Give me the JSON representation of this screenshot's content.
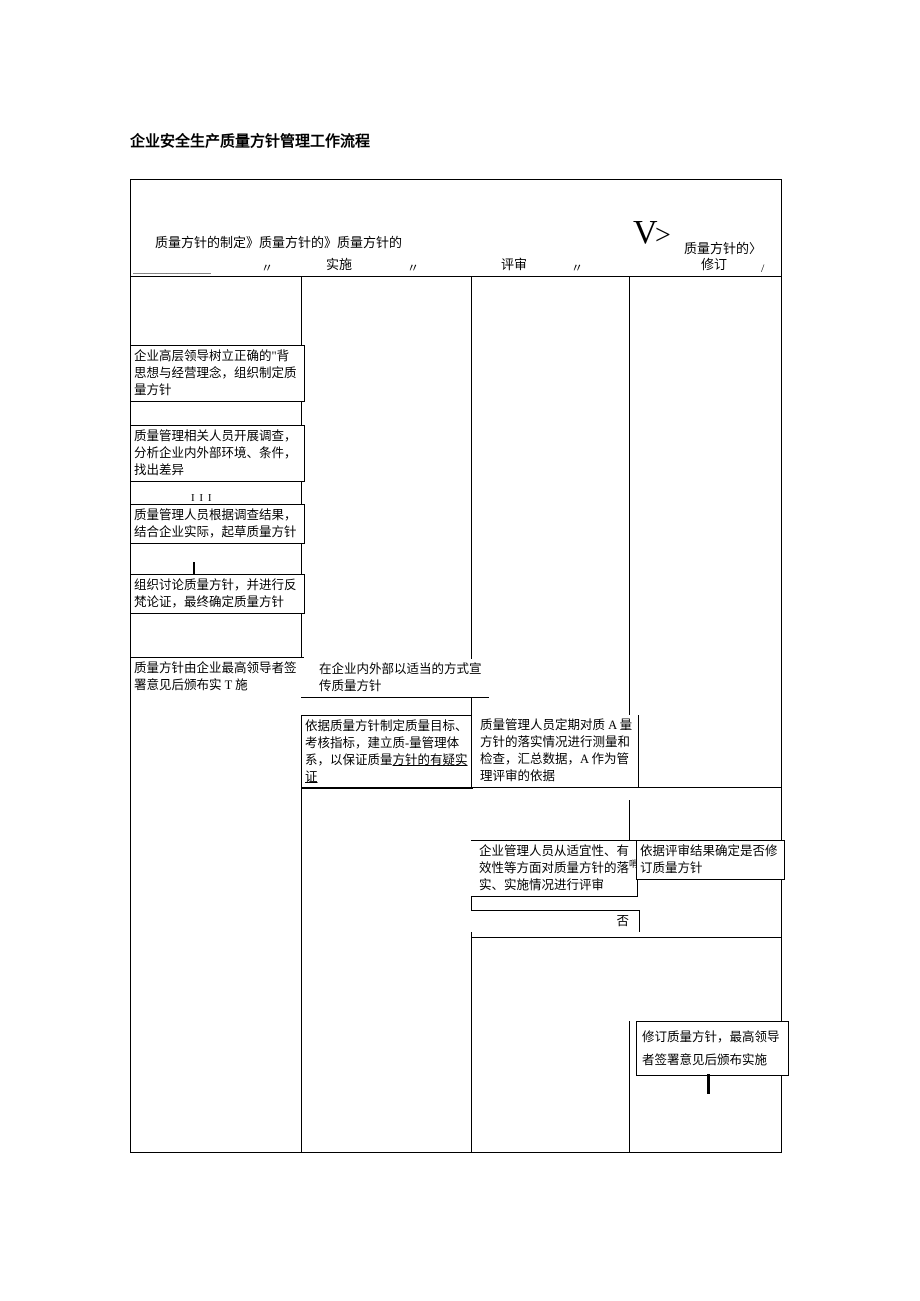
{
  "title": "企业安全生产质量方针管理工作流程",
  "header": {
    "seg1": "质量方针的制定》质量方针的》质量方针的",
    "seg2": "实施",
    "seg3": "评审",
    "seg4pre": "质量方针的〉",
    "seg4": "修订",
    "mark1": "〃",
    "mark2": "〃",
    "mark3": "〃",
    "mark4": "/"
  },
  "boxes": {
    "a1": "企业高层领导树立正确的\"背思想与经营理念，组织制定质量方针",
    "a2": "质量管理相关人员开展调查，分析企业内外部环境、条件，找出差异",
    "a3": "质量管理人员根据调查结果，结合企业实际，起草质量方针",
    "a4": "组织讨论质量方针，并进行反梵论证，最终确定质量方针",
    "a5": "质量方针由企业最高领导者签署意见后颁布实 T\n施",
    "b1": "在企业内外部以适当的方式宣传质量方针",
    "b2a": "依据质量方针制定质量目标、考核指标，建立质-量管理体系，以保证质量",
    "b2b": "方针的有疑实证",
    "c1": "质量管理人员定期对质 A 量方针的落实情况进行测量和检查，汇总数据，A 作为管理评审的依据",
    "c2": "企业管理人员从适宜性、有效性等方面对质量方针的落实、实施情况进行评审",
    "c3": "否",
    "d1": "依据评审结果确定是否修订质量方针",
    "d2": "修订质量方针，最高领导者签署意见后颁布实施",
    "side_small": "哨"
  }
}
